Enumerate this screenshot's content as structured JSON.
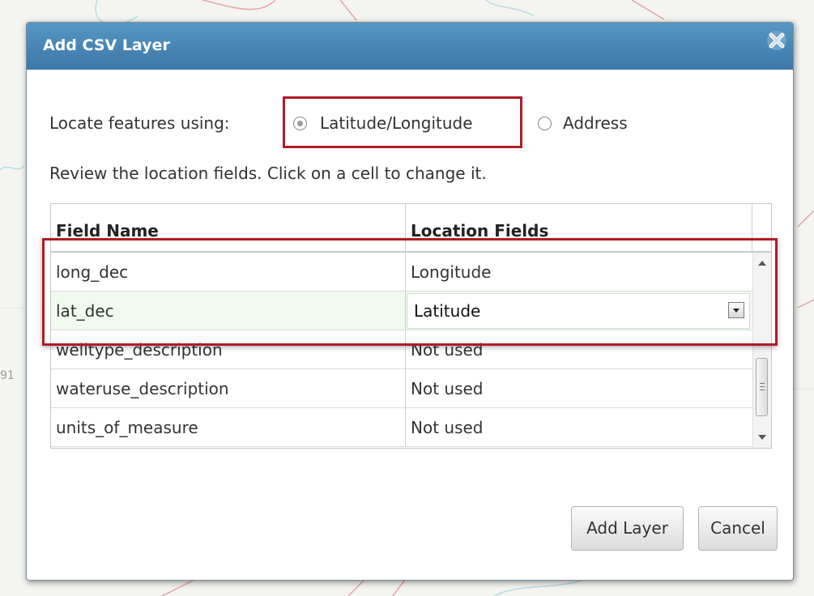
{
  "dialog": {
    "title": "Add CSV Layer",
    "close_icon": "close-x-icon"
  },
  "locate": {
    "label": "Locate features using:",
    "options": [
      {
        "label": "Latitude/Longitude",
        "selected": true
      },
      {
        "label": "Address",
        "selected": false
      }
    ]
  },
  "review_text": "Review the location fields. Click on a cell to change it.",
  "grid": {
    "headers": [
      "Field Name",
      "Location Fields"
    ],
    "rows": [
      {
        "field": "long_dec",
        "location": "Longitude"
      },
      {
        "field": "lat_dec",
        "location": "Latitude",
        "editing": true
      },
      {
        "field": "welltype_description",
        "location": "Not used"
      },
      {
        "field": "wateruse_description",
        "location": "Not used"
      },
      {
        "field": "units_of_measure",
        "location": "Not used"
      }
    ]
  },
  "buttons": {
    "add_layer": "Add Layer",
    "cancel": "Cancel"
  },
  "background": {
    "map_label": "91"
  },
  "colors": {
    "titlebar": "#4a87b8",
    "highlight": "#b01c26",
    "selected_row": "#f0faef"
  }
}
